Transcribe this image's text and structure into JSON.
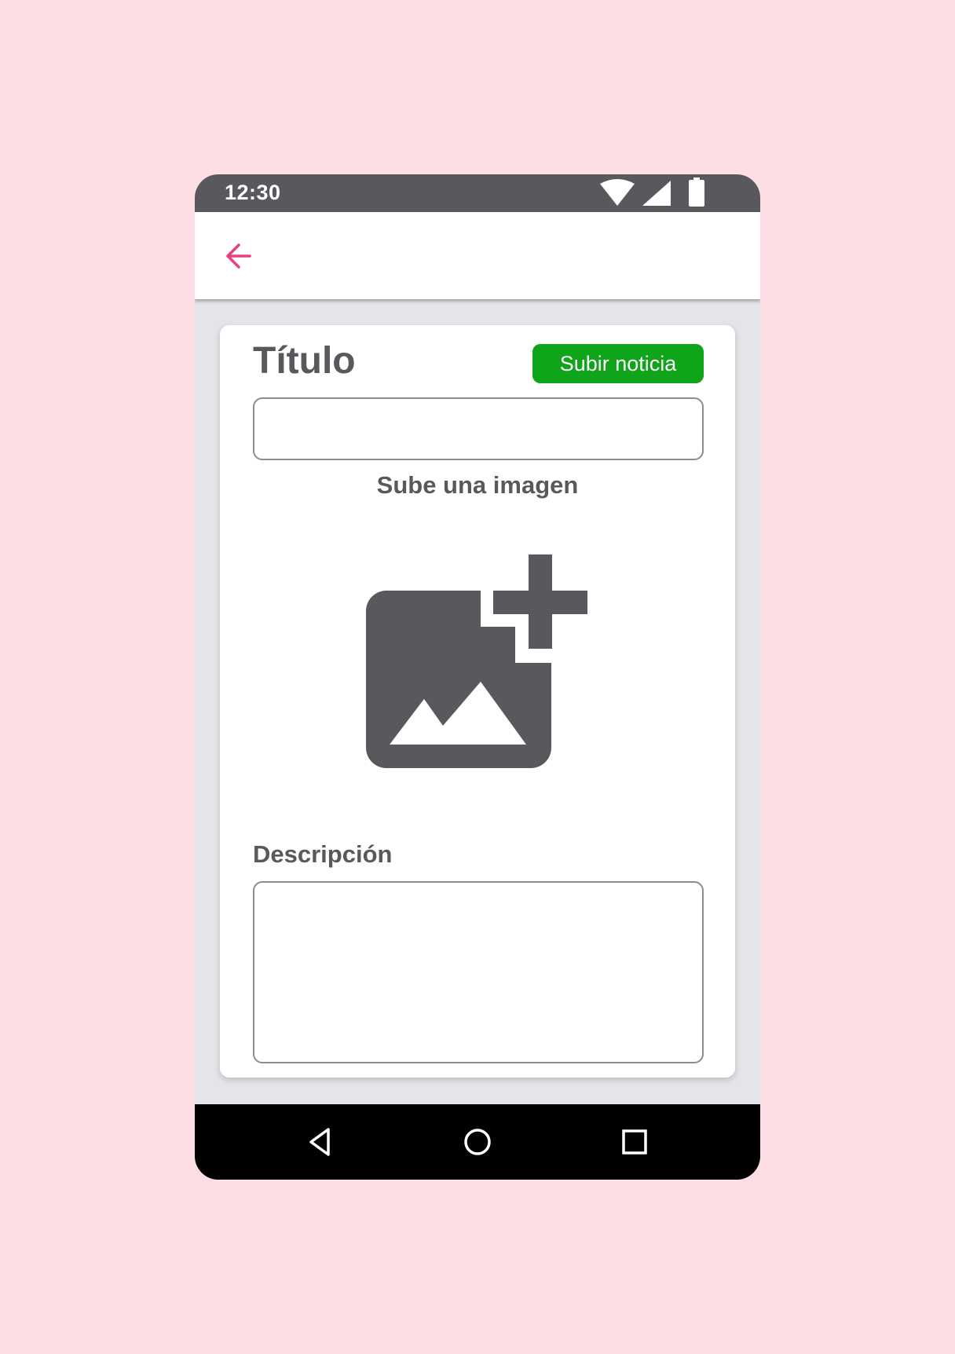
{
  "status_bar": {
    "time": "12:30",
    "icons": [
      "wifi-icon",
      "cellular-signal-icon",
      "battery-icon"
    ]
  },
  "app_bar": {
    "back_icon": "arrow-left-icon",
    "accent_color": "#e83e82"
  },
  "form": {
    "title_label": "Título",
    "submit_label": "Subir noticia",
    "submit_color": "#10a41b",
    "title_value": "",
    "image_label": "Sube una imagen",
    "image_icon": "add-photo-icon",
    "description_label": "Descripción",
    "description_value": ""
  },
  "nav_bar": {
    "buttons": [
      "back-triangle-icon",
      "home-circle-icon",
      "recents-square-icon"
    ]
  },
  "colors": {
    "background": "#fddee4",
    "status_bar": "#58595d",
    "text_dark": "#58595d",
    "screen_background": "#e4e5e9"
  }
}
